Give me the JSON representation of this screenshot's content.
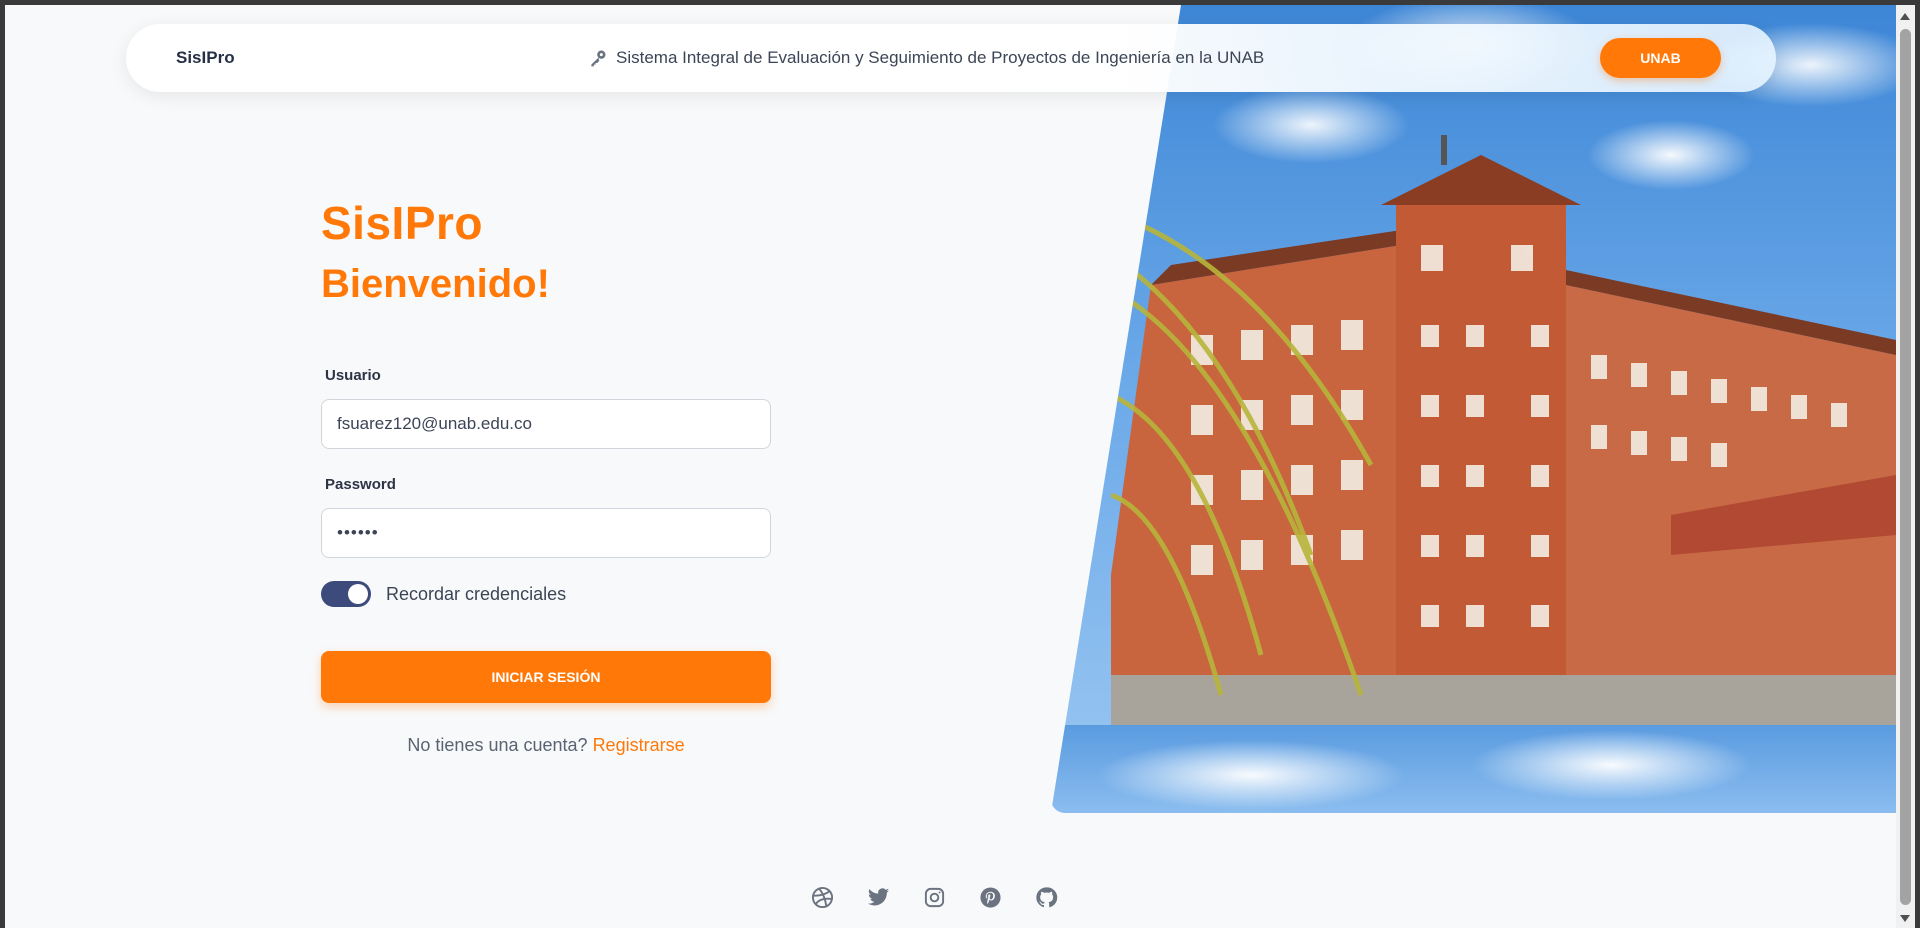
{
  "navbar": {
    "brand": "SisIPro",
    "subtitle": "Sistema Integral de Evaluación y Seguimiento de Proyectos de Ingeniería en la UNAB",
    "subtitle_icon": "key-icon",
    "button_label": "UNAB"
  },
  "login": {
    "brand": "SisIPro",
    "welcome": "Bienvenido!",
    "user_label": "Usuario",
    "user_value": "fsuarez120@unab.edu.co",
    "password_label": "Password",
    "password_value": "••••••",
    "remember_label": "Recordar credenciales",
    "remember_checked": true,
    "submit_label": "INICIAR SESIÓN",
    "register_prompt": "No tienes una cuenta?",
    "register_link": "Registrarse"
  },
  "social": [
    "dribbble-icon",
    "twitter-icon",
    "instagram-icon",
    "pinterest-icon",
    "github-icon"
  ],
  "colors": {
    "accent": "#ff7808",
    "toggle": "#3d4a7c",
    "text_dark": "#253047",
    "background": "#f8f9fa"
  }
}
